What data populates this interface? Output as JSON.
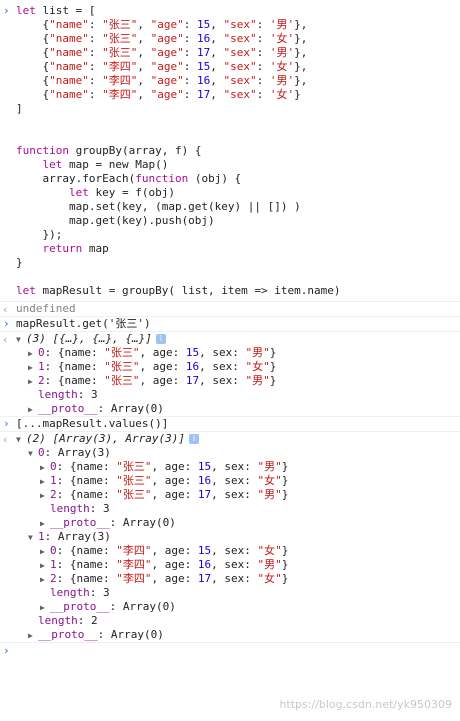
{
  "code": {
    "l1": "let list = [",
    "items": [
      {
        "name": "张三",
        "age": "15",
        "sex": "男"
      },
      {
        "name": "张三",
        "age": "16",
        "sex": "女"
      },
      {
        "name": "张三",
        "age": "17",
        "sex": "男"
      },
      {
        "name": "李四",
        "age": "15",
        "sex": "女"
      },
      {
        "name": "李四",
        "age": "16",
        "sex": "男"
      },
      {
        "name": "李四",
        "age": "17",
        "sex": "女"
      }
    ],
    "close": "]",
    "fn": [
      "function groupBy(array, f) {",
      "    let map = new Map()",
      "    array.forEach(function (obj) {",
      "        let key = f(obj)",
      "        map.set(key, (map.get(key) || []) )",
      "        map.get(key).push(obj)",
      "    });",
      "    return map",
      "}"
    ],
    "mapres": "let mapResult = groupBy( list, item => item.name)"
  },
  "undefined_text": "undefined",
  "cmd2": "mapResult.get('张三')",
  "res2": {
    "summary": "(3) [{…}, {…}, {…}]",
    "rows": [
      {
        "idx": "0",
        "name": "张三",
        "age": "15",
        "sex": "男"
      },
      {
        "idx": "1",
        "name": "张三",
        "age": "16",
        "sex": "女"
      },
      {
        "idx": "2",
        "name": "张三",
        "age": "17",
        "sex": "男"
      }
    ],
    "length": "length: 3",
    "proto": "__proto__: Array(0)"
  },
  "cmd3": "[...mapResult.values()]",
  "res3": {
    "summary": "(2) [Array(3), Array(3)]",
    "groups": [
      {
        "label": "0: Array(3)",
        "rows": [
          {
            "idx": "0",
            "name": "张三",
            "age": "15",
            "sex": "男"
          },
          {
            "idx": "1",
            "name": "张三",
            "age": "16",
            "sex": "女"
          },
          {
            "idx": "2",
            "name": "张三",
            "age": "17",
            "sex": "男"
          }
        ],
        "length": "length: 3",
        "proto": "__proto__: Array(0)"
      },
      {
        "label": "1: Array(3)",
        "rows": [
          {
            "idx": "0",
            "name": "李四",
            "age": "15",
            "sex": "女"
          },
          {
            "idx": "1",
            "name": "李四",
            "age": "16",
            "sex": "男"
          },
          {
            "idx": "2",
            "name": "李四",
            "age": "17",
            "sex": "女"
          }
        ],
        "length": "length: 3",
        "proto": "__proto__: Array(0)"
      }
    ],
    "length": "length: 2",
    "proto": "__proto__: Array(0)"
  },
  "watermark": "https://blog.csdn.net/yk950309",
  "colors": {
    "string": "#c41a16",
    "number": "#1c00cf",
    "keyword": "#aa0d91",
    "prompt": "#1a73e8"
  }
}
